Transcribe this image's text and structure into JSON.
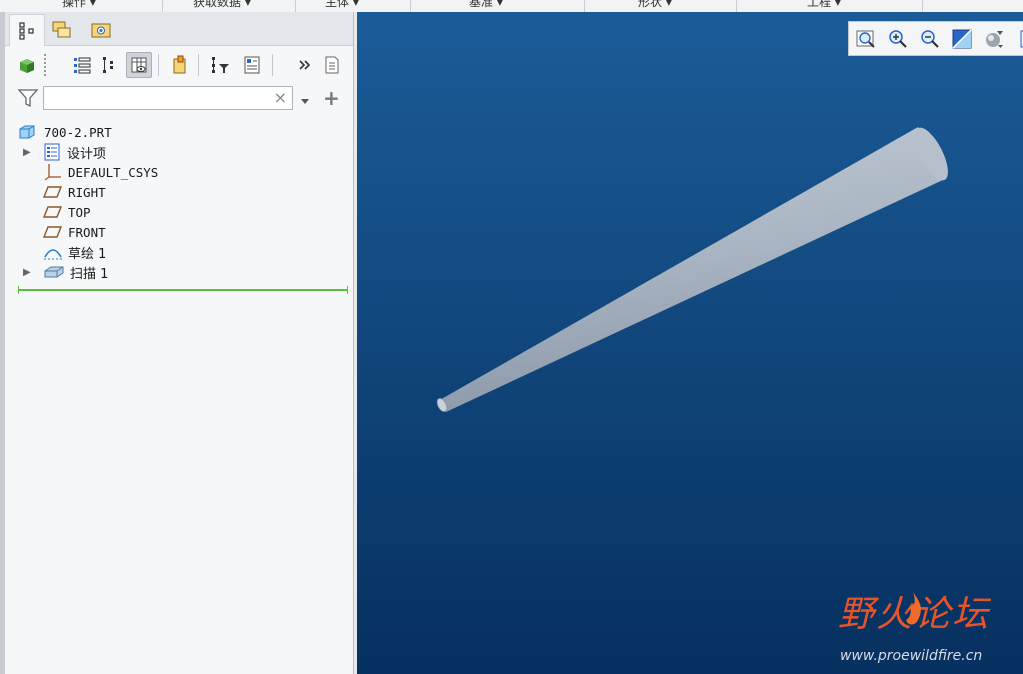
{
  "ribbon": {
    "groups": [
      "操作 ▾",
      "获取数据 ▾",
      "主体 ▾",
      "基准 ▾",
      "形状 ▾",
      "工程 ▾"
    ]
  },
  "model_tree": {
    "filter_placeholder": "",
    "root": "700-2.PRT",
    "items": [
      {
        "label": "设计项",
        "icon": "design-items-icon",
        "expandable": true
      },
      {
        "label": "DEFAULT_CSYS",
        "icon": "csys-icon",
        "expandable": false
      },
      {
        "label": "RIGHT",
        "icon": "datum-plane-icon",
        "expandable": false
      },
      {
        "label": "TOP",
        "icon": "datum-plane-icon",
        "expandable": false
      },
      {
        "label": "FRONT",
        "icon": "datum-plane-icon",
        "expandable": false
      },
      {
        "label": "草绘 1",
        "icon": "sketch-icon",
        "expandable": false
      },
      {
        "label": "扫描 1",
        "icon": "sweep-icon",
        "expandable": true
      }
    ]
  },
  "viewport": {
    "background_top": "#1b5c98",
    "background_bottom": "#06305f",
    "model_color": "#a9b4c2"
  },
  "watermark": {
    "title": "野火论坛",
    "url": "www.proewildfire.cn",
    "title_color": "#e8542a"
  }
}
